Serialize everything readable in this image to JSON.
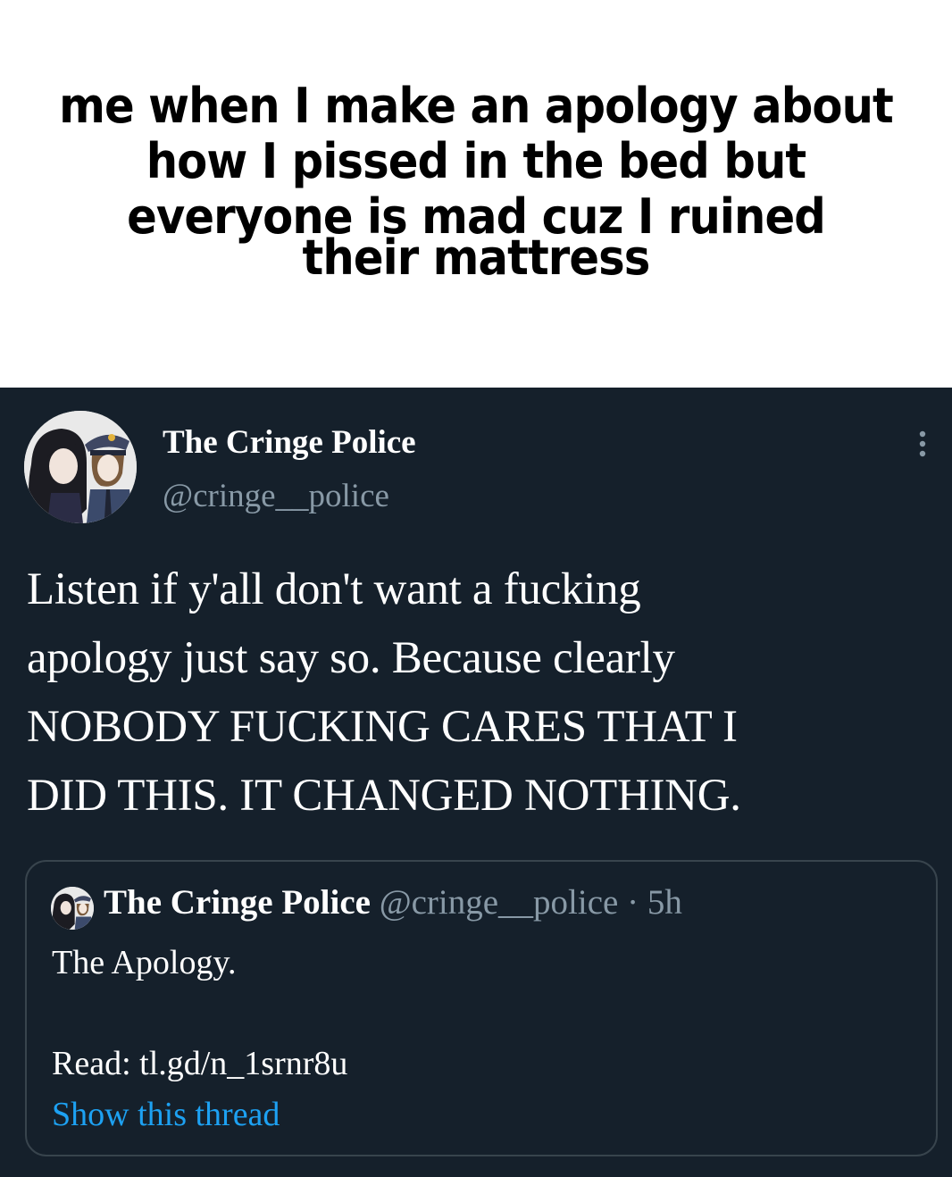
{
  "meme": {
    "caption_lines": [
      "me when I make an apology about",
      "how I pissed in the bed but",
      "everyone is mad cuz I ruined",
      "their mattress"
    ]
  },
  "tweet": {
    "author_name": "The Cringe Police",
    "author_handle": "@cringe__police",
    "more_icon": "more-vertical-icon",
    "body": "Listen if y'all don't want a fucking\napology just say so. Because clearly\nNOBODY FUCKING CARES THAT I\nDID THIS. IT CHANGED NOTHING.",
    "quote": {
      "author_name": "The Cringe Police",
      "author_handle": "@cringe__police",
      "separator": "·",
      "time": "5h",
      "text": "The Apology.",
      "link_text": "Read: tl.gd/n_1srnr8u",
      "show_thread": "Show this thread"
    }
  },
  "colors": {
    "tweet_background": "#15202b",
    "secondary_text": "#8899a6",
    "link": "#1da1f2",
    "border": "#38444d"
  }
}
